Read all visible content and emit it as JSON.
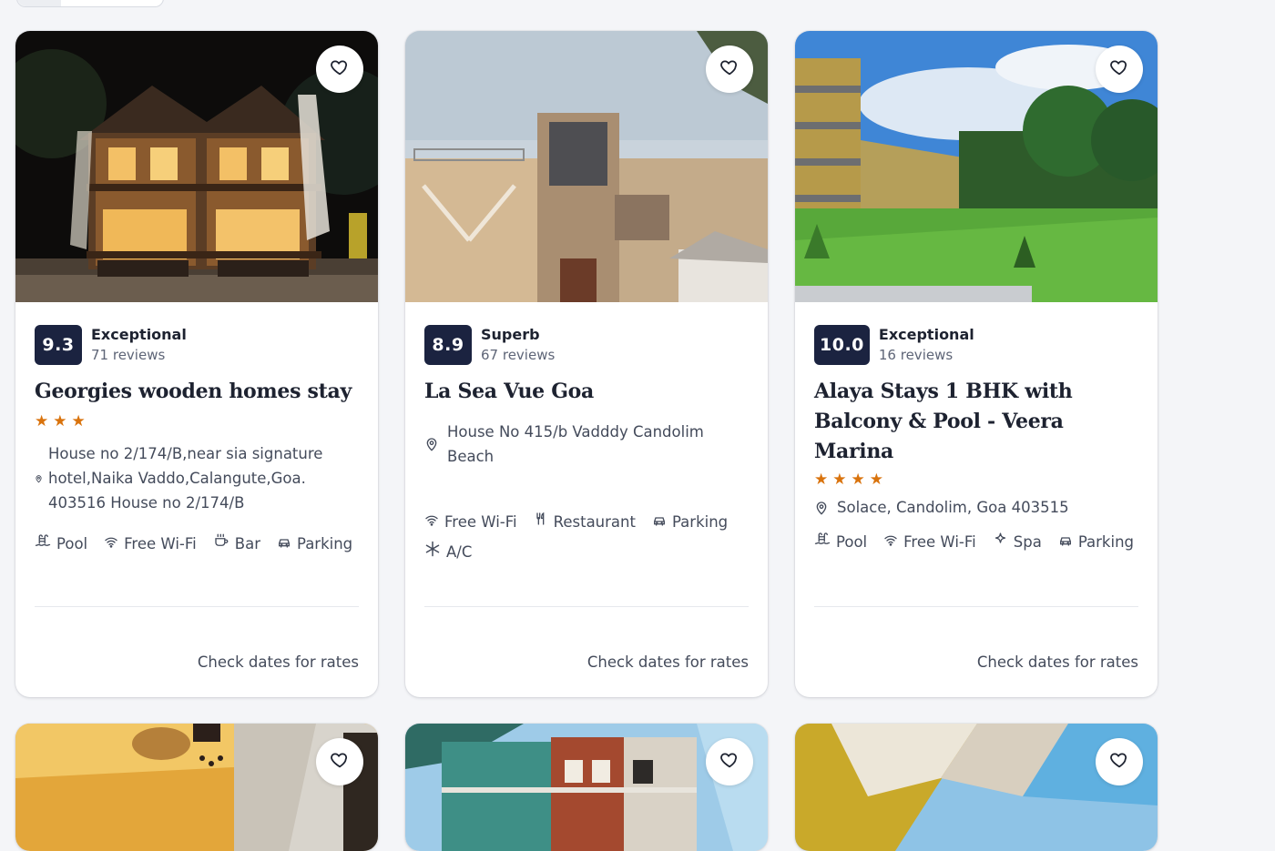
{
  "cards": [
    {
      "score": "9.3",
      "rating_label": "Exceptional",
      "reviews": "71 reviews",
      "title": "Georgies wooden homes stay",
      "star_count": 3,
      "location": "House no 2/174/B,near sia signature hotel,Naika Vaddo,Calangute,Goa. 403516 House no 2/174/B",
      "amenities": [
        {
          "icon": "pool-icon",
          "label": "Pool"
        },
        {
          "icon": "wifi-icon",
          "label": "Free Wi-Fi"
        },
        {
          "icon": "bar-icon",
          "label": "Bar"
        },
        {
          "icon": "parking-icon",
          "label": "Parking"
        }
      ],
      "rates_label": "Check dates for rates"
    },
    {
      "score": "8.9",
      "rating_label": "Superb",
      "reviews": "67 reviews",
      "title": "La Sea Vue Goa",
      "star_count": 0,
      "location": "House No 415/b Vadddy Candolim Beach",
      "amenities": [
        {
          "icon": "wifi-icon",
          "label": "Free Wi-Fi"
        },
        {
          "icon": "restaurant-icon",
          "label": "Restaurant"
        },
        {
          "icon": "parking-icon",
          "label": "Parking"
        },
        {
          "icon": "ac-icon",
          "label": "A/C"
        }
      ],
      "rates_label": "Check dates for rates"
    },
    {
      "score": "10.0",
      "rating_label": "Exceptional",
      "reviews": "16 reviews",
      "title": "Alaya Stays 1 BHK with Balcony & Pool - Veera Marina",
      "star_count": 4,
      "location": "Solace, Candolim, Goa 403515",
      "amenities": [
        {
          "icon": "pool-icon",
          "label": "Pool"
        },
        {
          "icon": "wifi-icon",
          "label": "Free Wi-Fi"
        },
        {
          "icon": "spa-icon",
          "label": "Spa"
        },
        {
          "icon": "parking-icon",
          "label": "Parking"
        }
      ],
      "rates_label": "Check dates for rates"
    }
  ],
  "colors": {
    "score_bg": "#1b2340",
    "star": "#d9730d",
    "page_bg": "#f4f5f8"
  }
}
